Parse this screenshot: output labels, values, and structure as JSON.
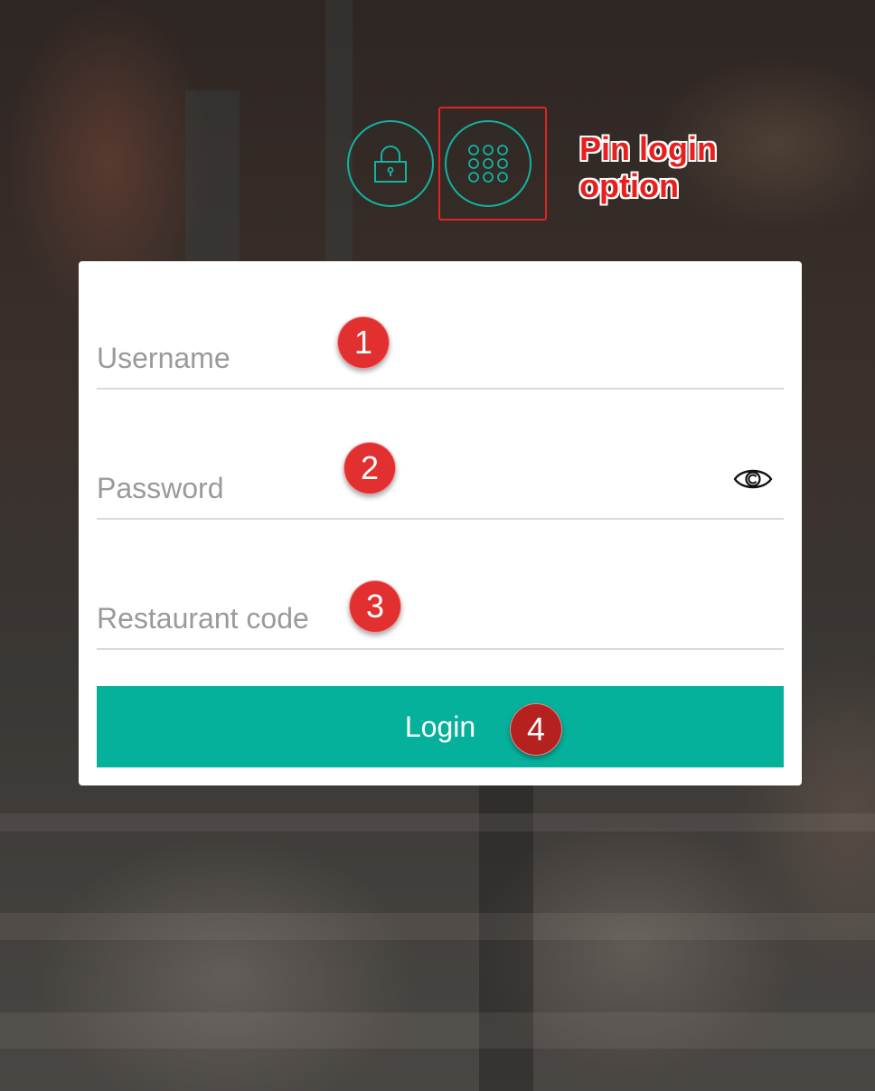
{
  "login_mode_toggle": {
    "options": [
      {
        "name": "password-login",
        "icon": "lock-icon"
      },
      {
        "name": "pin-login",
        "icon": "keypad-icon"
      }
    ],
    "accent_color": "#12b3a0"
  },
  "annotation": {
    "callout_line1": "Pin login",
    "callout_line2": "option",
    "callout_color": "#e81f1f"
  },
  "form": {
    "username": {
      "placeholder": "Username",
      "value": ""
    },
    "password": {
      "placeholder": "Password",
      "value": ""
    },
    "restaurant_code": {
      "placeholder": "Restaurant code",
      "value": ""
    },
    "show_password_icon": "eye-icon",
    "login_label": "Login",
    "login_color": "#06b19c"
  },
  "step_badges": [
    "1",
    "2",
    "3",
    "4"
  ]
}
